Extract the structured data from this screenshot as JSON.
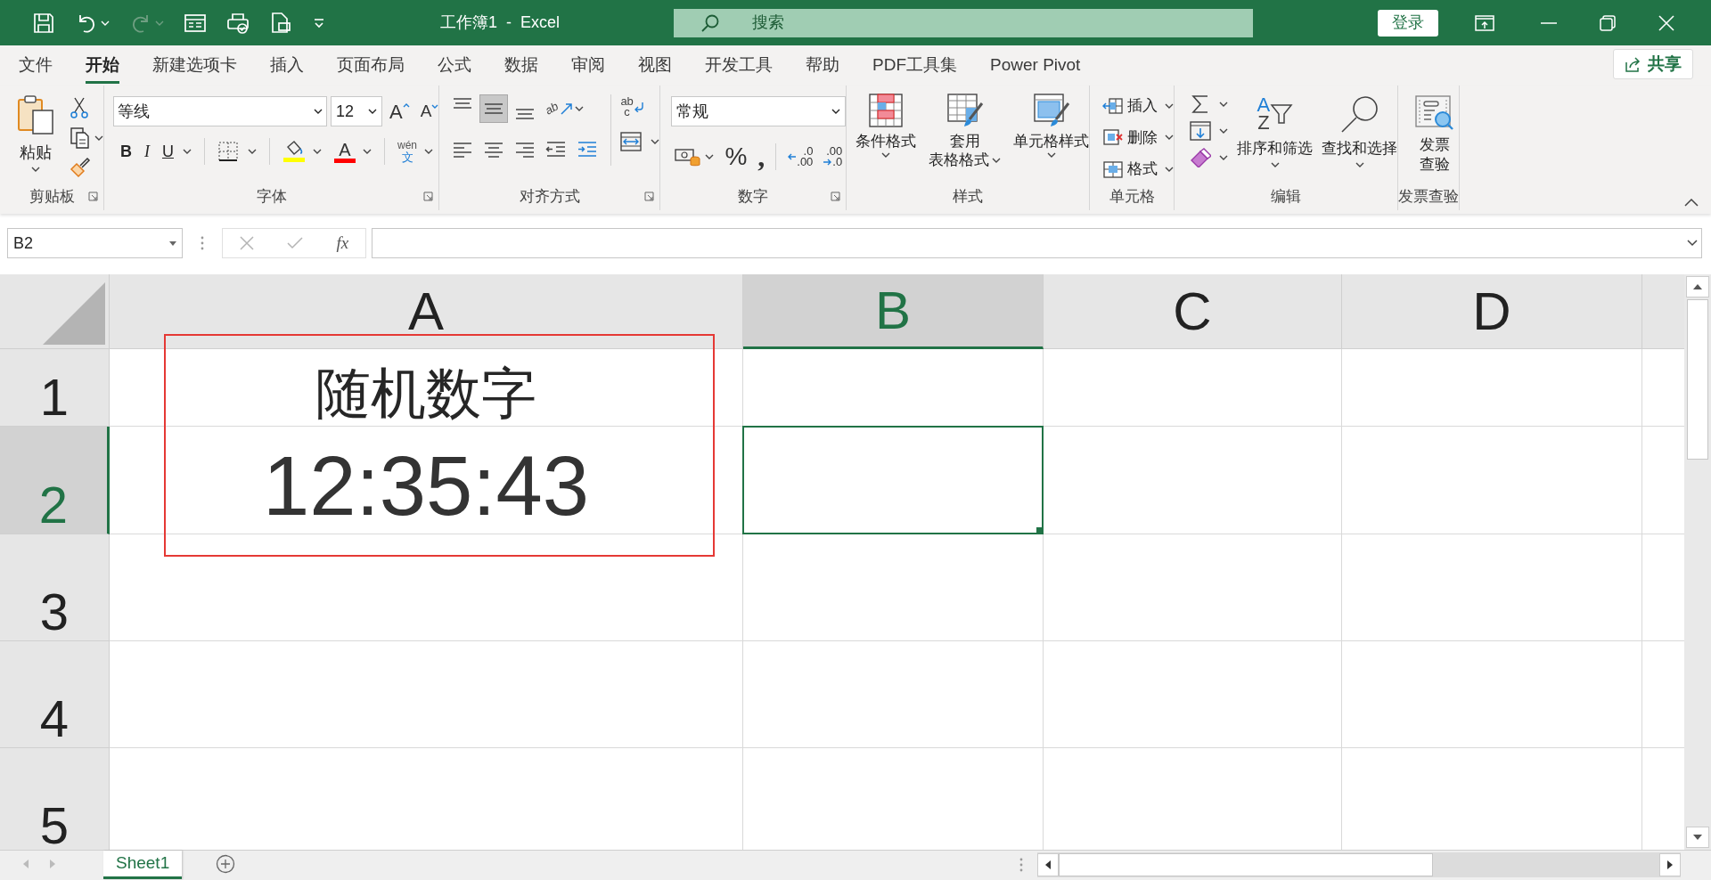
{
  "title_bar": {
    "quick_access": [
      {
        "kind": "save",
        "disabled": false
      },
      {
        "kind": "undo",
        "disabled": false
      },
      {
        "kind": "redo",
        "disabled": true
      },
      {
        "kind": "form",
        "disabled": false
      },
      {
        "kind": "print_preview",
        "disabled": false
      },
      {
        "kind": "document",
        "disabled": false
      },
      {
        "kind": "customize",
        "disabled": false
      }
    ],
    "title": "工作簿1  -  Excel",
    "search": {
      "placeholder": "搜索"
    },
    "sign_in": "登录"
  },
  "tabs": [
    {
      "label": "文件",
      "selected": false
    },
    {
      "label": "开始",
      "selected": true
    },
    {
      "label": "新建选项卡",
      "selected": false
    },
    {
      "label": "插入",
      "selected": false
    },
    {
      "label": "页面布局",
      "selected": false
    },
    {
      "label": "公式",
      "selected": false
    },
    {
      "label": "数据",
      "selected": false
    },
    {
      "label": "审阅",
      "selected": false
    },
    {
      "label": "视图",
      "selected": false
    },
    {
      "label": "开发工具",
      "selected": false
    },
    {
      "label": "帮助",
      "selected": false
    },
    {
      "label": "PDF工具集",
      "selected": false
    },
    {
      "label": "Power Pivot",
      "selected": false
    }
  ],
  "share": "共享",
  "ribbon": {
    "clipboard": {
      "label": "剪贴板",
      "paste": "粘贴"
    },
    "font": {
      "label": "字体",
      "font_name": "等线",
      "font_size": "12",
      "grow": "A",
      "shrink": "A",
      "bold": "B",
      "italic": "I",
      "underline": "U",
      "font_color": "A",
      "phonetic": {
        "top": "wén",
        "bottom": "文"
      }
    },
    "alignment": {
      "label": "对齐方式",
      "buttons": [
        {
          "kind": "top",
          "selected": false
        },
        {
          "kind": "middle",
          "selected": true
        },
        {
          "kind": "bottom",
          "selected": false
        },
        {
          "kind": "left",
          "selected": false
        },
        {
          "kind": "center",
          "selected": false
        },
        {
          "kind": "right",
          "selected": false
        }
      ],
      "orientation": "ab",
      "wrap": {
        "top": "ab",
        "bottom": "c"
      }
    },
    "number": {
      "label": "数字",
      "format": "常规",
      "percent": "%",
      "comma": ",",
      "increase_decimal": [
        ".0",
        ".00"
      ],
      "decrease_decimal": [
        ".00",
        ".0"
      ]
    },
    "styles": {
      "label": "样式",
      "buttons": [
        {
          "kind": "conditional",
          "lines": [
            "条件格式"
          ]
        },
        {
          "kind": "table",
          "lines": [
            "套用",
            "表格格式"
          ]
        },
        {
          "kind": "cell_styles",
          "lines": [
            "单元格样式"
          ]
        }
      ]
    },
    "cells": {
      "label": "单元格",
      "buttons": [
        {
          "kind": "insert",
          "label": "插入"
        },
        {
          "kind": "delete",
          "label": "删除"
        },
        {
          "kind": "format",
          "label": "格式"
        }
      ]
    },
    "editing": {
      "label": "编辑",
      "sort": {
        "letters": [
          "A",
          "Z"
        ],
        "label": "排序和筛选"
      },
      "find": "查找和选择"
    },
    "invoice": {
      "label": "发票查验",
      "lines": [
        "发票",
        "查验"
      ]
    }
  },
  "formula_bar": {
    "name_box": "B2",
    "function_label": "fx"
  },
  "sheet": {
    "columns": [
      {
        "label": "A",
        "selected": false
      },
      {
        "label": "B",
        "selected": true
      },
      {
        "label": "C",
        "selected": false
      },
      {
        "label": "D",
        "selected": false
      }
    ],
    "rows": [
      {
        "label": "1",
        "selected": false,
        "cells": [
          "随机数字"
        ]
      },
      {
        "label": "2",
        "selected": true,
        "cells": [
          "12:35:43"
        ]
      },
      {
        "label": "3",
        "selected": false
      },
      {
        "label": "4",
        "selected": false
      },
      {
        "label": "5",
        "selected": false
      }
    ]
  },
  "sheet_tabs": [
    {
      "label": "Sheet1",
      "selected": true
    }
  ]
}
